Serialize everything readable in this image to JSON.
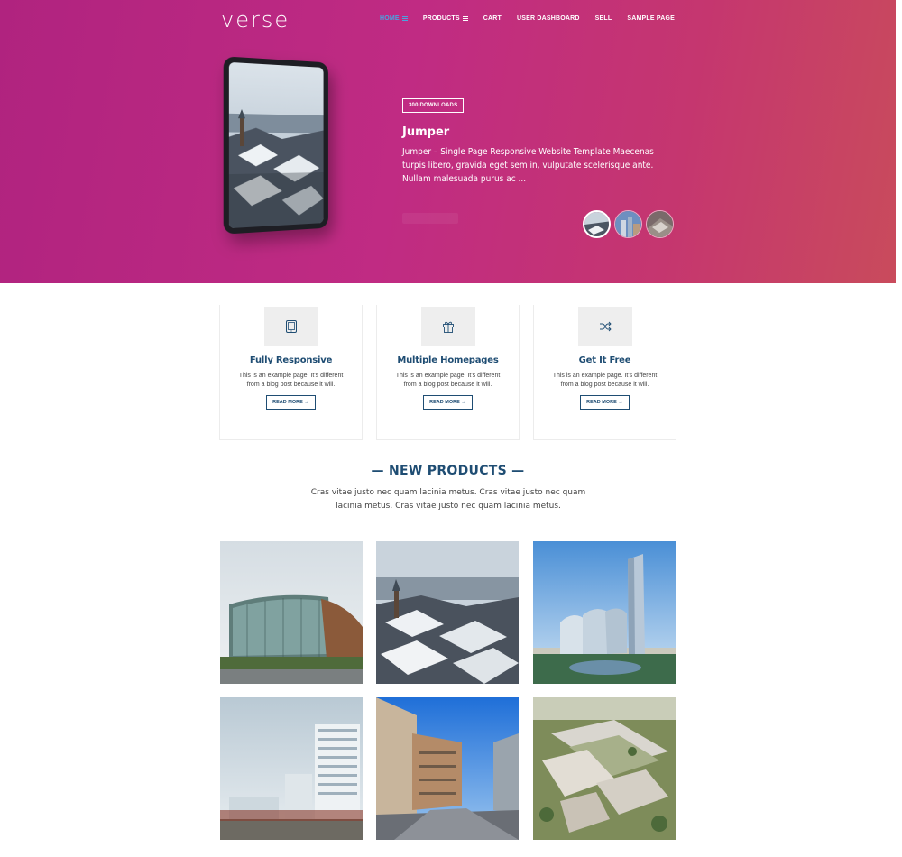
{
  "header": {
    "logo": "verse",
    "nav": [
      {
        "label": "HOME",
        "has_menu": true,
        "active": true
      },
      {
        "label": "PRODUCTS",
        "has_menu": true,
        "active": false
      },
      {
        "label": "CART",
        "has_menu": false,
        "active": false
      },
      {
        "label": "USER DASHBOARD",
        "has_menu": false,
        "active": false
      },
      {
        "label": "SELL",
        "has_menu": false,
        "active": false
      },
      {
        "label": "SAMPLE PAGE",
        "has_menu": false,
        "active": false
      }
    ]
  },
  "hero": {
    "badge": "300 DOWNLOADS",
    "title": "Jumper",
    "description": "Jumper – Single Page Responsive Website Template Maecenas turpis libero, gravida eget sem in, vulputate scelerisque ante. Nullam malesuada purus ac ...",
    "thumbnails": [
      "city-thumb-1",
      "city-thumb-2",
      "city-thumb-3"
    ]
  },
  "features": [
    {
      "icon": "tablet-icon",
      "title": "Fully Responsive",
      "text": "This is an example page. It's different from a blog post because it will.",
      "button": "READ MORE →"
    },
    {
      "icon": "gift-icon",
      "title": "Multiple Homepages",
      "text": "This is an example page. It's different from a blog post because it will.",
      "button": "READ MORE →"
    },
    {
      "icon": "shuffle-icon",
      "title": "Get It Free",
      "text": "This is an example page. It's different from a blog post because it will.",
      "button": "READ MORE →"
    }
  ],
  "new_products": {
    "title": "— NEW PRODUCTS —",
    "subtitle": "Cras vitae justo nec quam lacinia metus. Cras vitae justo nec quam lacinia metus. Cras vitae justo nec quam lacinia metus."
  },
  "colors": {
    "hero_gradient_start": "#b0237f",
    "hero_gradient_end": "#c94b5c",
    "accent_blue": "#1f4d73",
    "nav_active": "#4aa3df"
  }
}
